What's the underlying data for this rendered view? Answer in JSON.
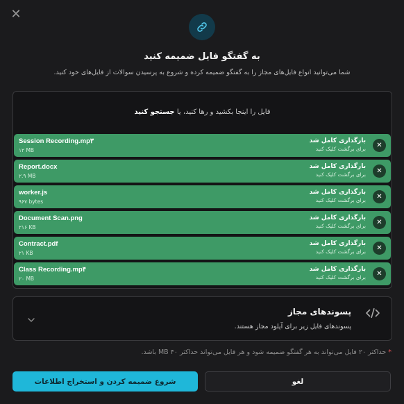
{
  "dialog": {
    "title": "به گفتگو فایل ضمیمه کنید",
    "subtitle": "شما می‌توانید انواع فایل‌های مجاز را به گفتگو ضمیمه کرده و شروع به پرسیدن سوالات از فایل‌های خود کنید."
  },
  "dropzone": {
    "text": "فایل را اینجا بکشید و رها کنید، یا",
    "browse": "جستجو کنید"
  },
  "files": [
    {
      "name": "Session Recording.mp۳",
      "size": "۱۲ MB",
      "status": "بارگذاری کامل شد",
      "hint": "برای برگشت کلیک کنید"
    },
    {
      "name": "Report.docx",
      "size": "۲.۹ MB",
      "status": "بارگذاری کامل شد",
      "hint": "برای برگشت کلیک کنید"
    },
    {
      "name": "worker.js",
      "size": "۹۶۷ bytes",
      "status": "بارگذاری کامل شد",
      "hint": "برای برگشت کلیک کنید"
    },
    {
      "name": "Document Scan.png",
      "size": "۲۱۶ KB",
      "status": "بارگذاری کامل شد",
      "hint": "برای برگشت کلیک کنید"
    },
    {
      "name": "Contract.pdf",
      "size": "۲۱ KB",
      "status": "بارگذاری کامل شد",
      "hint": "برای برگشت کلیک کنید"
    },
    {
      "name": "Class Recording.mp۴",
      "size": "۲۰ MB",
      "status": "بارگذاری کامل شد",
      "hint": "برای برگشت کلیک کنید"
    }
  ],
  "extensions": {
    "title": "پسوندهای مجاز",
    "description": "پسوندهای فایل زیر برای آپلود مجاز هستند."
  },
  "note": {
    "star": "*",
    "text": "حداکثر ۲۰ فایل می‌تواند به هر گفتگو ضمیمه شود و هر فایل می‌تواند حداکثر ۴۰ MB باشد."
  },
  "buttons": {
    "start": "شروع ضمیمه کردن و استخراج اطلاعات",
    "cancel": "لغو"
  },
  "colors": {
    "accent": "#1fb7d9",
    "file_row": "#3e9a66",
    "background": "#1b1b1d"
  },
  "icons": {
    "close": "close-icon",
    "attach": "paperclip-icon",
    "remove": "remove-x-icon",
    "code": "code-icon",
    "expand": "chevron-down-icon"
  }
}
